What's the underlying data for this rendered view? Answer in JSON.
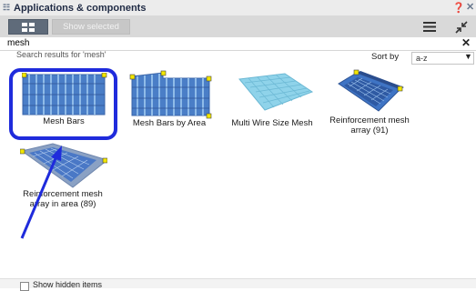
{
  "window": {
    "title": "Applications & components",
    "icons": [
      "grip-icon",
      "help-icon",
      "close-icon"
    ]
  },
  "toolbar": {
    "show_selected_label": "Show selected",
    "view_button_icon": "grid-view-icon",
    "menu_icon": "hamburger-menu-icon",
    "collapse_icon": "collapse-arrows-icon"
  },
  "search": {
    "value": "mesh",
    "clear_icon": "clear-x-icon"
  },
  "results": {
    "summary_text": "Search results for 'mesh'",
    "sort_label": "Sort by",
    "sort_value": "a-z"
  },
  "components": [
    {
      "label": "Mesh Bars",
      "icon": "mesh-bars-icon",
      "selected": true
    },
    {
      "label": "Mesh Bars by Area",
      "icon": "mesh-bars-by-area-icon"
    },
    {
      "label": "Multi Wire Size Mesh",
      "icon": "multi-wire-size-mesh-icon"
    },
    {
      "label": "Reinforcement mesh array (91)",
      "icon": "reinforcement-mesh-array-icon"
    },
    {
      "label": "Reinforcement mesh array in area (89)",
      "icon": "reinforcement-mesh-array-in-area-icon"
    }
  ],
  "annotation": {
    "color": "#1f2bdc"
  },
  "footer": {
    "label": "Show hidden items"
  }
}
